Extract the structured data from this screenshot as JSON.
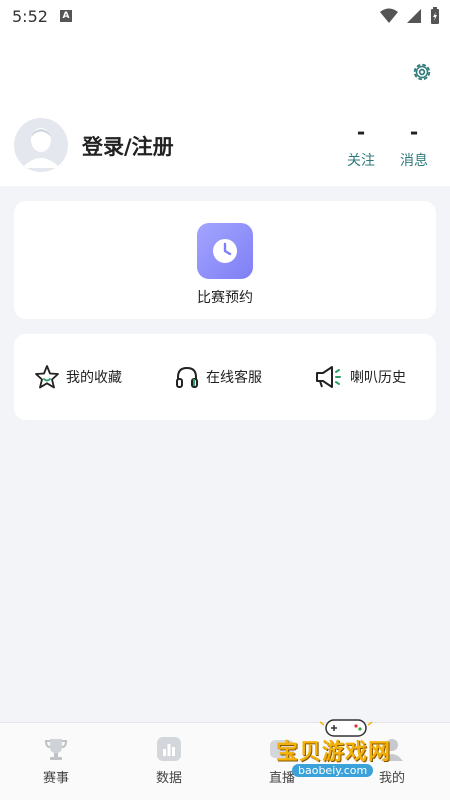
{
  "status_bar": {
    "time": "5:52",
    "badge": "A"
  },
  "profile": {
    "login_label": "登录/注册",
    "stats": [
      {
        "value": "-",
        "label": "关注"
      },
      {
        "value": "-",
        "label": "消息"
      }
    ]
  },
  "reserve": {
    "label": "比赛预约",
    "icon": "clock-icon",
    "accent": "#8f90fa"
  },
  "tools": [
    {
      "label": "我的收藏",
      "icon": "star-icon"
    },
    {
      "label": "在线客服",
      "icon": "headset-icon"
    },
    {
      "label": "喇叭历史",
      "icon": "megaphone-icon"
    }
  ],
  "nav": [
    {
      "label": "赛事",
      "icon": "trophy-icon"
    },
    {
      "label": "数据",
      "icon": "chart-icon"
    },
    {
      "label": "直播",
      "icon": "tv-icon"
    },
    {
      "label": "我的",
      "icon": "user-icon"
    }
  ],
  "watermark": {
    "text": "宝贝游戏网",
    "url": "baobeiy.com"
  },
  "colors": {
    "accent_teal": "#2e7a7a",
    "background": "#f2f4f8"
  }
}
